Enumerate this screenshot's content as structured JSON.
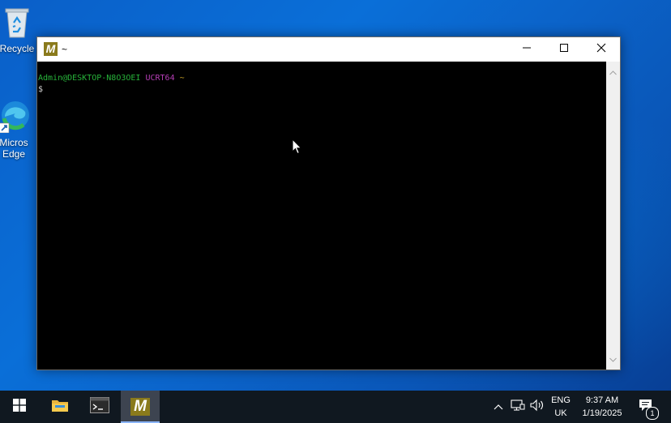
{
  "desktop": {
    "icons": [
      {
        "label": "Recycle",
        "icon": "recycle-bin-icon"
      },
      {
        "label": "Micros Edge",
        "icon": "edge-icon"
      }
    ]
  },
  "window": {
    "title": "~",
    "app_icon_letter": "M",
    "controls": {
      "minimize": "minimize-icon",
      "maximize": "maximize-icon",
      "close": "close-icon"
    }
  },
  "terminal": {
    "user_host": "Admin@DESKTOP-N8O3OEI",
    "env": "UCRT64",
    "path": "~",
    "prompt": "$"
  },
  "taskbar": {
    "items": [
      "windows-start-icon",
      "file-explorer-icon",
      "terminal-icon",
      "msys2-icon"
    ],
    "active_app_letter": "M",
    "tray": {
      "lang_line1": "ENG",
      "lang_line2": "UK",
      "time": "9:37 AM",
      "date": "1/19/2025",
      "notification_count": "1"
    }
  },
  "colors": {
    "user_host": "#27b33a",
    "env": "#b63eb6",
    "path": "#c9a227",
    "msys_accent": "#8a7a1c"
  }
}
